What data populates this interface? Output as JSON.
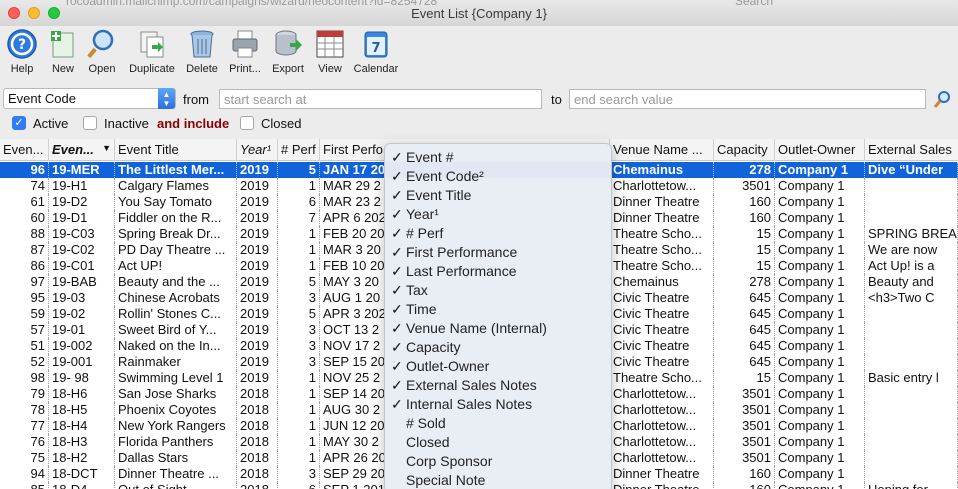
{
  "ghost_text": {
    "left": "rocoadmin.mallchimp.com/campaigns/wizard/neocontent?id=8254728",
    "right": "Search"
  },
  "window": {
    "title": "Event List {Company 1}"
  },
  "toolbar": [
    {
      "name": "help",
      "icon": "help-icon",
      "label": "Help"
    },
    {
      "name": "new",
      "icon": "new-document-icon",
      "label": "New"
    },
    {
      "name": "open",
      "icon": "magnifier-icon",
      "label": "Open"
    },
    {
      "name": "duplicate",
      "icon": "duplicate-icon",
      "label": "Duplicate"
    },
    {
      "name": "delete",
      "icon": "trash-can-icon",
      "label": "Delete"
    },
    {
      "name": "print",
      "icon": "printer-icon",
      "label": "Print..."
    },
    {
      "name": "export",
      "icon": "database-export-icon",
      "label": "Export"
    },
    {
      "name": "view",
      "icon": "spreadsheet-view-icon",
      "label": "View"
    },
    {
      "name": "calendar",
      "icon": "calendar-icon",
      "label": "Calendar"
    }
  ],
  "search": {
    "field_value": "Event Code",
    "from_label": "from",
    "from_placeholder": "start search at",
    "to_label": "to",
    "to_placeholder": "end search value"
  },
  "filters": {
    "active": {
      "label": "Active",
      "checked": true
    },
    "inactive": {
      "label": "Inactive",
      "checked": false
    },
    "and_include": "and include",
    "closed": {
      "label": "Closed",
      "checked": false
    }
  },
  "table": {
    "columns": [
      "Even...",
      "Even...",
      "Event Title",
      "Year¹",
      "# Perf",
      "First Perfo",
      "Venue Name ...",
      "Capacity",
      "Outlet-Owner",
      "External Sales"
    ],
    "rows": [
      {
        "num": "96",
        "code": "19-MER",
        "title": "The Littlest Mer...",
        "year": "2019",
        "perf": "5",
        "first": "JAN 17 20",
        "venue": "Chemainus",
        "capacity": "278",
        "owner": "Company 1",
        "ext": "Dive “Under",
        "selected": true
      },
      {
        "num": "74",
        "code": "19-H1",
        "title": "Calgary Flames",
        "year": "2019",
        "perf": "1",
        "first": "MAR 29 2",
        "venue": "Charlottetow...",
        "capacity": "3501",
        "owner": "Company 1",
        "ext": ""
      },
      {
        "num": "61",
        "code": "19-D2",
        "title": "You Say Tomato",
        "year": "2019",
        "perf": "6",
        "first": "MAR 23 2",
        "venue": "Dinner Theatre",
        "capacity": "160",
        "owner": "Company 1",
        "ext": ""
      },
      {
        "num": "60",
        "code": "19-D1",
        "title": "Fiddler on the R...",
        "year": "2019",
        "perf": "7",
        "first": "APR 6 202",
        "venue": "Dinner Theatre",
        "capacity": "160",
        "owner": "Company 1",
        "ext": ""
      },
      {
        "num": "88",
        "code": "19-C03",
        "title": "Spring Break Dr...",
        "year": "2019",
        "perf": "1",
        "first": "FEB 20 20",
        "venue": "Theatre Scho...",
        "capacity": "15",
        "owner": "Company 1",
        "ext": "SPRING BREA"
      },
      {
        "num": "87",
        "code": "19-C02",
        "title": "PD Day Theatre ...",
        "year": "2019",
        "perf": "1",
        "first": "MAR 3 20",
        "venue": "Theatre Scho...",
        "capacity": "15",
        "owner": "Company 1",
        "ext": "We are now"
      },
      {
        "num": "86",
        "code": "19-C01",
        "title": "Act UP!",
        "year": "2019",
        "perf": "1",
        "first": "FEB 10 20",
        "venue": "Theatre Scho...",
        "capacity": "15",
        "owner": "Company 1",
        "ext": "Act Up! is a"
      },
      {
        "num": "97",
        "code": "19-BAB",
        "title": "Beauty and the ...",
        "year": "2019",
        "perf": "5",
        "first": "MAY 3 20",
        "venue": "Chemainus",
        "capacity": "278",
        "owner": "Company 1",
        "ext": "Beauty and"
      },
      {
        "num": "95",
        "code": "19-03",
        "title": "Chinese Acrobats",
        "year": "2019",
        "perf": "3",
        "first": "AUG 1 20",
        "venue": "Civic Theatre",
        "capacity": "645",
        "owner": "Company 1",
        "ext": "<h3>Two C"
      },
      {
        "num": "59",
        "code": "19-02",
        "title": "Rollin' Stones C...",
        "year": "2019",
        "perf": "5",
        "first": "APR 3 202",
        "venue": "Civic Theatre",
        "capacity": "645",
        "owner": "Company 1",
        "ext": ""
      },
      {
        "num": "57",
        "code": "19-01",
        "title": "Sweet Bird of Y...",
        "year": "2019",
        "perf": "3",
        "first": "OCT 13 2",
        "venue": "Civic Theatre",
        "capacity": "645",
        "owner": "Company 1",
        "ext": ""
      },
      {
        "num": "51",
        "code": "19-002",
        "title": "Naked on the In...",
        "year": "2019",
        "perf": "3",
        "first": "NOV 17 2",
        "venue": "Civic Theatre",
        "capacity": "645",
        "owner": "Company 1",
        "ext": ""
      },
      {
        "num": "52",
        "code": "19-001",
        "title": "Rainmaker",
        "year": "2019",
        "perf": "3",
        "first": "SEP 15 20",
        "venue": "Civic Theatre",
        "capacity": "645",
        "owner": "Company 1",
        "ext": ""
      },
      {
        "num": "98",
        "code": "19- 98",
        "title": "Swimming Level 1",
        "year": "2019",
        "perf": "1",
        "first": "NOV 25 2",
        "venue": "Theatre Scho...",
        "capacity": "15",
        "owner": "Company 1",
        "ext": "Basic entry l"
      },
      {
        "num": "79",
        "code": "18-H6",
        "title": "San Jose Sharks",
        "year": "2018",
        "perf": "1",
        "first": "SEP 14 20",
        "venue": "Charlottetow...",
        "capacity": "3501",
        "owner": "Company 1",
        "ext": ""
      },
      {
        "num": "78",
        "code": "18-H5",
        "title": "Phoenix Coyotes",
        "year": "2018",
        "perf": "1",
        "first": "AUG 30 2",
        "venue": "Charlottetow...",
        "capacity": "3501",
        "owner": "Company 1",
        "ext": ""
      },
      {
        "num": "77",
        "code": "18-H4",
        "title": "New York Rangers",
        "year": "2018",
        "perf": "1",
        "first": "JUN 12 20",
        "venue": "Charlottetow...",
        "capacity": "3501",
        "owner": "Company 1",
        "ext": ""
      },
      {
        "num": "76",
        "code": "18-H3",
        "title": "Florida Panthers",
        "year": "2018",
        "perf": "1",
        "first": "MAY 30 2",
        "venue": "Charlottetow...",
        "capacity": "3501",
        "owner": "Company 1",
        "ext": ""
      },
      {
        "num": "75",
        "code": "18-H2",
        "title": "Dallas Stars",
        "year": "2018",
        "perf": "1",
        "first": "APR 26 20",
        "venue": "Charlottetow...",
        "capacity": "3501",
        "owner": "Company 1",
        "ext": ""
      },
      {
        "num": "94",
        "code": "18-DCT",
        "title": "Dinner Theatre ...",
        "year": "2018",
        "perf": "3",
        "first": "SEP 29 20",
        "venue": "Dinner Theatre",
        "capacity": "160",
        "owner": "Company 1",
        "ext": ""
      },
      {
        "num": "85",
        "code": "18-D4",
        "title": "Out of Sight",
        "year": "2018",
        "perf": "6",
        "first": "SEP 1 201",
        "venue": "Dinner Theatre",
        "capacity": "160",
        "owner": "Company 1",
        "ext": "Hoping for"
      }
    ]
  },
  "column_menu": [
    {
      "label": "Event #",
      "checked": true
    },
    {
      "label": "Event Code²",
      "checked": true
    },
    {
      "label": "Event Title",
      "checked": true
    },
    {
      "label": "Year¹",
      "checked": true
    },
    {
      "label": "# Perf",
      "checked": true
    },
    {
      "label": "First Performance",
      "checked": true
    },
    {
      "label": "Last Performance",
      "checked": true
    },
    {
      "label": "Tax",
      "checked": true
    },
    {
      "label": "Time",
      "checked": true
    },
    {
      "label": "Venue Name (Internal)",
      "checked": true
    },
    {
      "label": "Capacity",
      "checked": true
    },
    {
      "label": "Outlet-Owner",
      "checked": true
    },
    {
      "label": "External Sales Notes",
      "checked": true
    },
    {
      "label": "Internal Sales Notes",
      "checked": true
    },
    {
      "label": "# Sold",
      "checked": false
    },
    {
      "label": "Closed",
      "checked": false
    },
    {
      "label": "Corp Sponsor",
      "checked": false
    },
    {
      "label": "Special Note",
      "checked": false
    }
  ]
}
